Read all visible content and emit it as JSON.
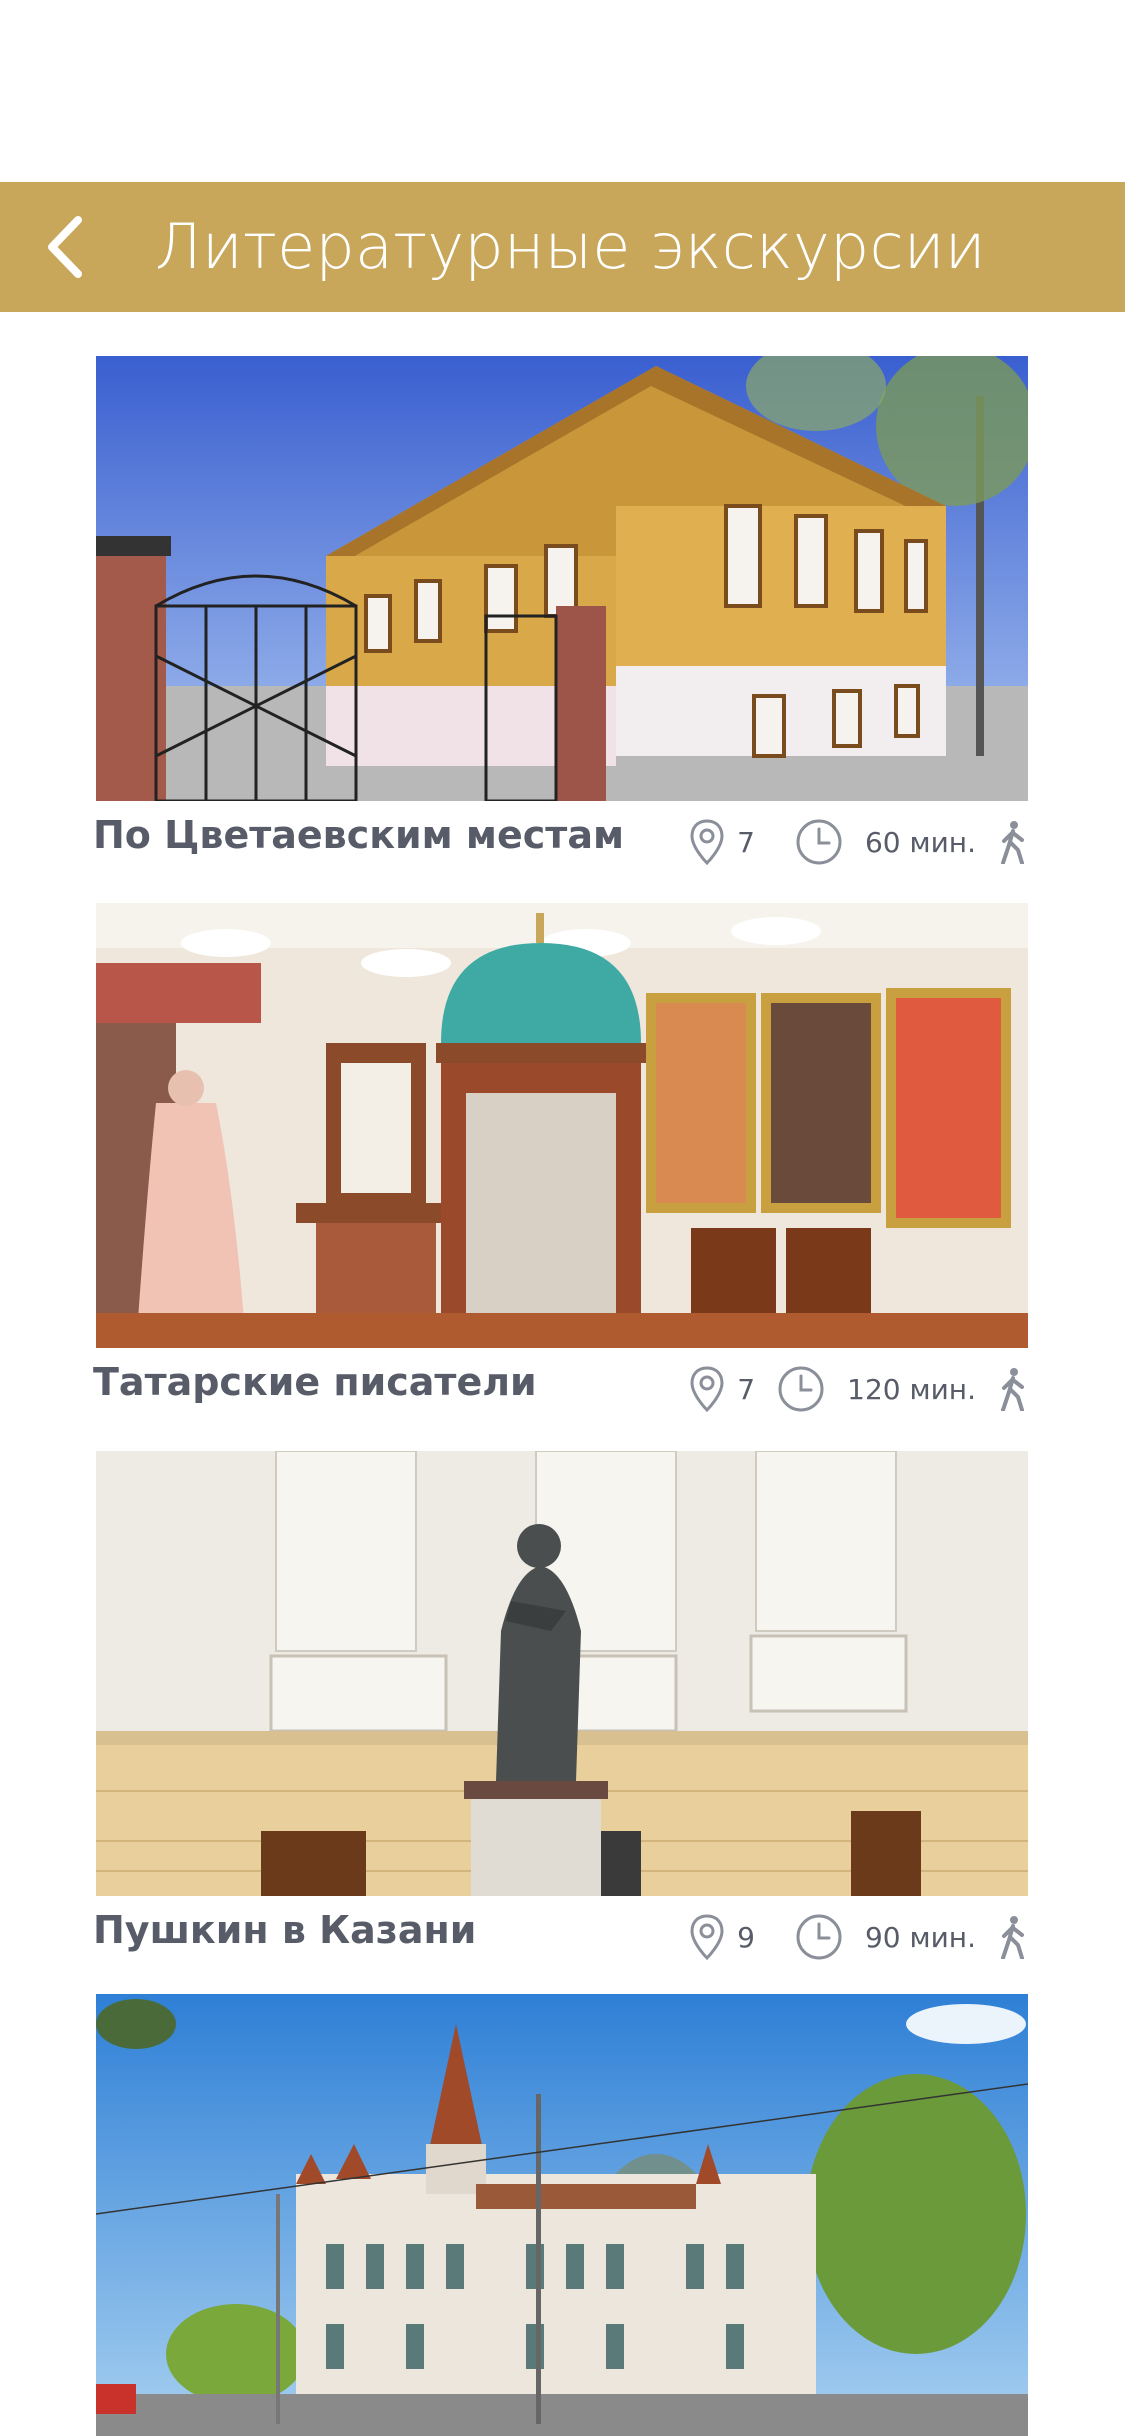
{
  "header": {
    "title": "Литературные экскурсии",
    "back_icon": "chevron-left-icon",
    "color": "#c8a65a"
  },
  "tours": [
    {
      "title": "По Цветаевским местам",
      "points": "7",
      "duration": "60 мин.",
      "mode_icon": "walking-icon",
      "image": "yellow-wooden-house"
    },
    {
      "title": "Татарские писатели",
      "points": "7",
      "duration": "120 мин.",
      "mode_icon": "walking-icon",
      "image": "museum-interior"
    },
    {
      "title": "Пушкин в Казани",
      "points": "9",
      "duration": "90 мин.",
      "mode_icon": "walking-icon",
      "image": "pushkin-statue"
    },
    {
      "title": "",
      "image": "castle-building"
    }
  ],
  "colors": {
    "text": "#575c68",
    "icon": "#8a8f99"
  }
}
